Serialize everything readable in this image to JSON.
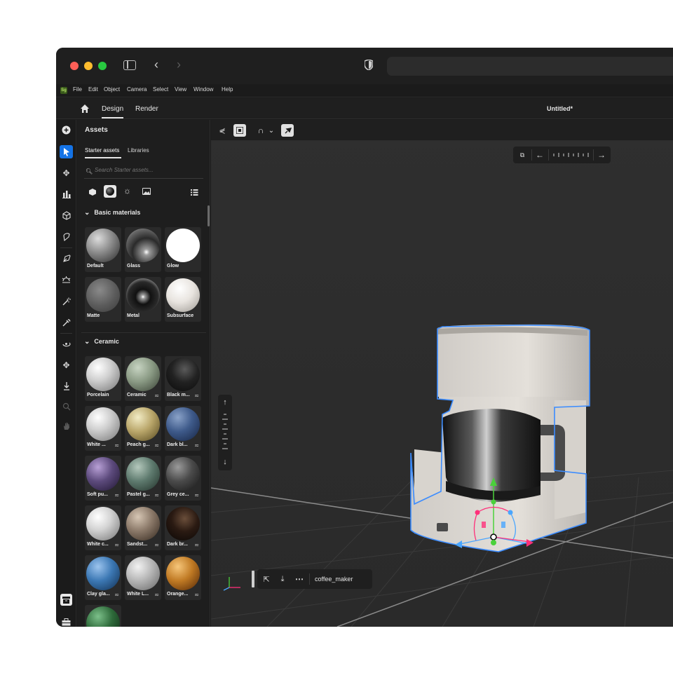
{
  "menu": [
    "File",
    "Edit",
    "Object",
    "Camera",
    "Select",
    "View",
    "Window",
    "Help"
  ],
  "app_logo": "Sg",
  "tabs": {
    "design": "Design",
    "render": "Render"
  },
  "doc_title": "Untitled*",
  "assets": {
    "title": "Assets",
    "subtabs": [
      "Starter assets",
      "Libraries"
    ],
    "search_placeholder": "Search Starter assets...",
    "sections": {
      "basic": "Basic materials",
      "ceramic": "Ceramic"
    },
    "basic_materials": [
      {
        "label": "Default",
        "tune": false
      },
      {
        "label": "Glass",
        "tune": false
      },
      {
        "label": "Glow",
        "tune": false
      },
      {
        "label": "Matte",
        "tune": false
      },
      {
        "label": "Metal",
        "tune": false
      },
      {
        "label": "Subsurface",
        "tune": false
      }
    ],
    "ceramic_materials": [
      {
        "label": "Porcelain",
        "tune": false
      },
      {
        "label": "Ceramic",
        "tune": true
      },
      {
        "label": "Black m...",
        "tune": true
      },
      {
        "label": "White ...",
        "tune": true
      },
      {
        "label": "Peach g...",
        "tune": true
      },
      {
        "label": "Dark bl...",
        "tune": true
      },
      {
        "label": "Soft pu...",
        "tune": true
      },
      {
        "label": "Pastel g...",
        "tune": true
      },
      {
        "label": "Grey ce...",
        "tune": true
      },
      {
        "label": "White c...",
        "tune": true
      },
      {
        "label": "Sandst...",
        "tune": true
      },
      {
        "label": "Dark br...",
        "tune": true
      },
      {
        "label": "Clay gla...",
        "tune": true
      },
      {
        "label": "White L...",
        "tune": true
      },
      {
        "label": "Orange...",
        "tune": true
      }
    ]
  },
  "viewport": {
    "object_name": "coffee_maker"
  },
  "colors": {
    "accent": "#1473e6",
    "selection": "#3b8cff",
    "gizmo_green": "#4ad13a",
    "gizmo_red": "#ff2f7a",
    "gizmo_blue": "#4aa6ff"
  }
}
